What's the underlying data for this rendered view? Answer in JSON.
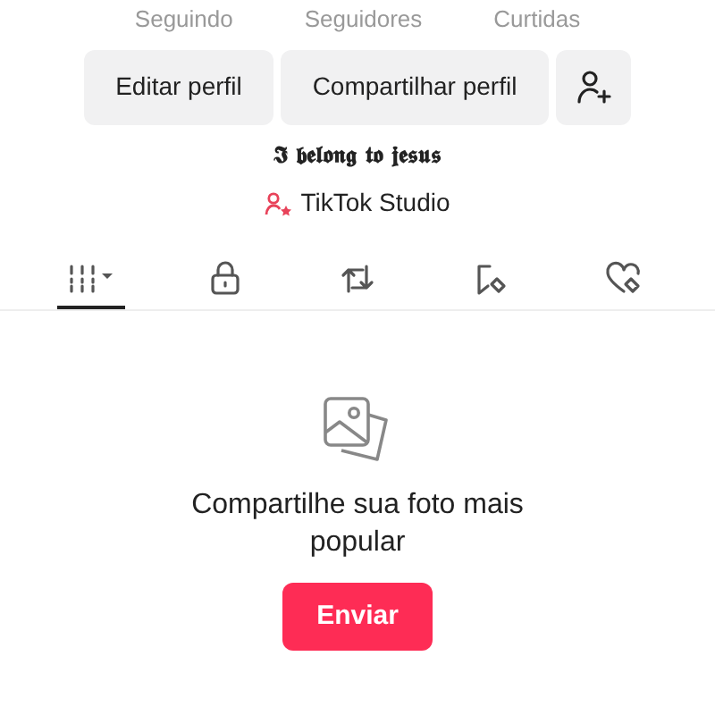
{
  "stats": [
    {
      "label": "Seguindo"
    },
    {
      "label": "Seguidores"
    },
    {
      "label": "Curtidas"
    }
  ],
  "actions": [
    {
      "label": "Editar perfil"
    },
    {
      "label": "Compartilhar perfil"
    }
  ],
  "bio": "𝕴 𝖇𝖊𝖑𝖔𝖓𝖌 𝖙𝖔 𝖏𝖊𝖘𝖚𝖘",
  "studio_link": "TikTok Studio",
  "tabs": [
    {
      "kind": "grid",
      "selected": true
    },
    {
      "kind": "lock",
      "selected": false
    },
    {
      "kind": "repost",
      "selected": false
    },
    {
      "kind": "saved",
      "selected": false
    },
    {
      "kind": "liked",
      "selected": false
    }
  ],
  "empty_state": {
    "message": "Compartilhe sua foto mais popular",
    "button": "Enviar"
  }
}
